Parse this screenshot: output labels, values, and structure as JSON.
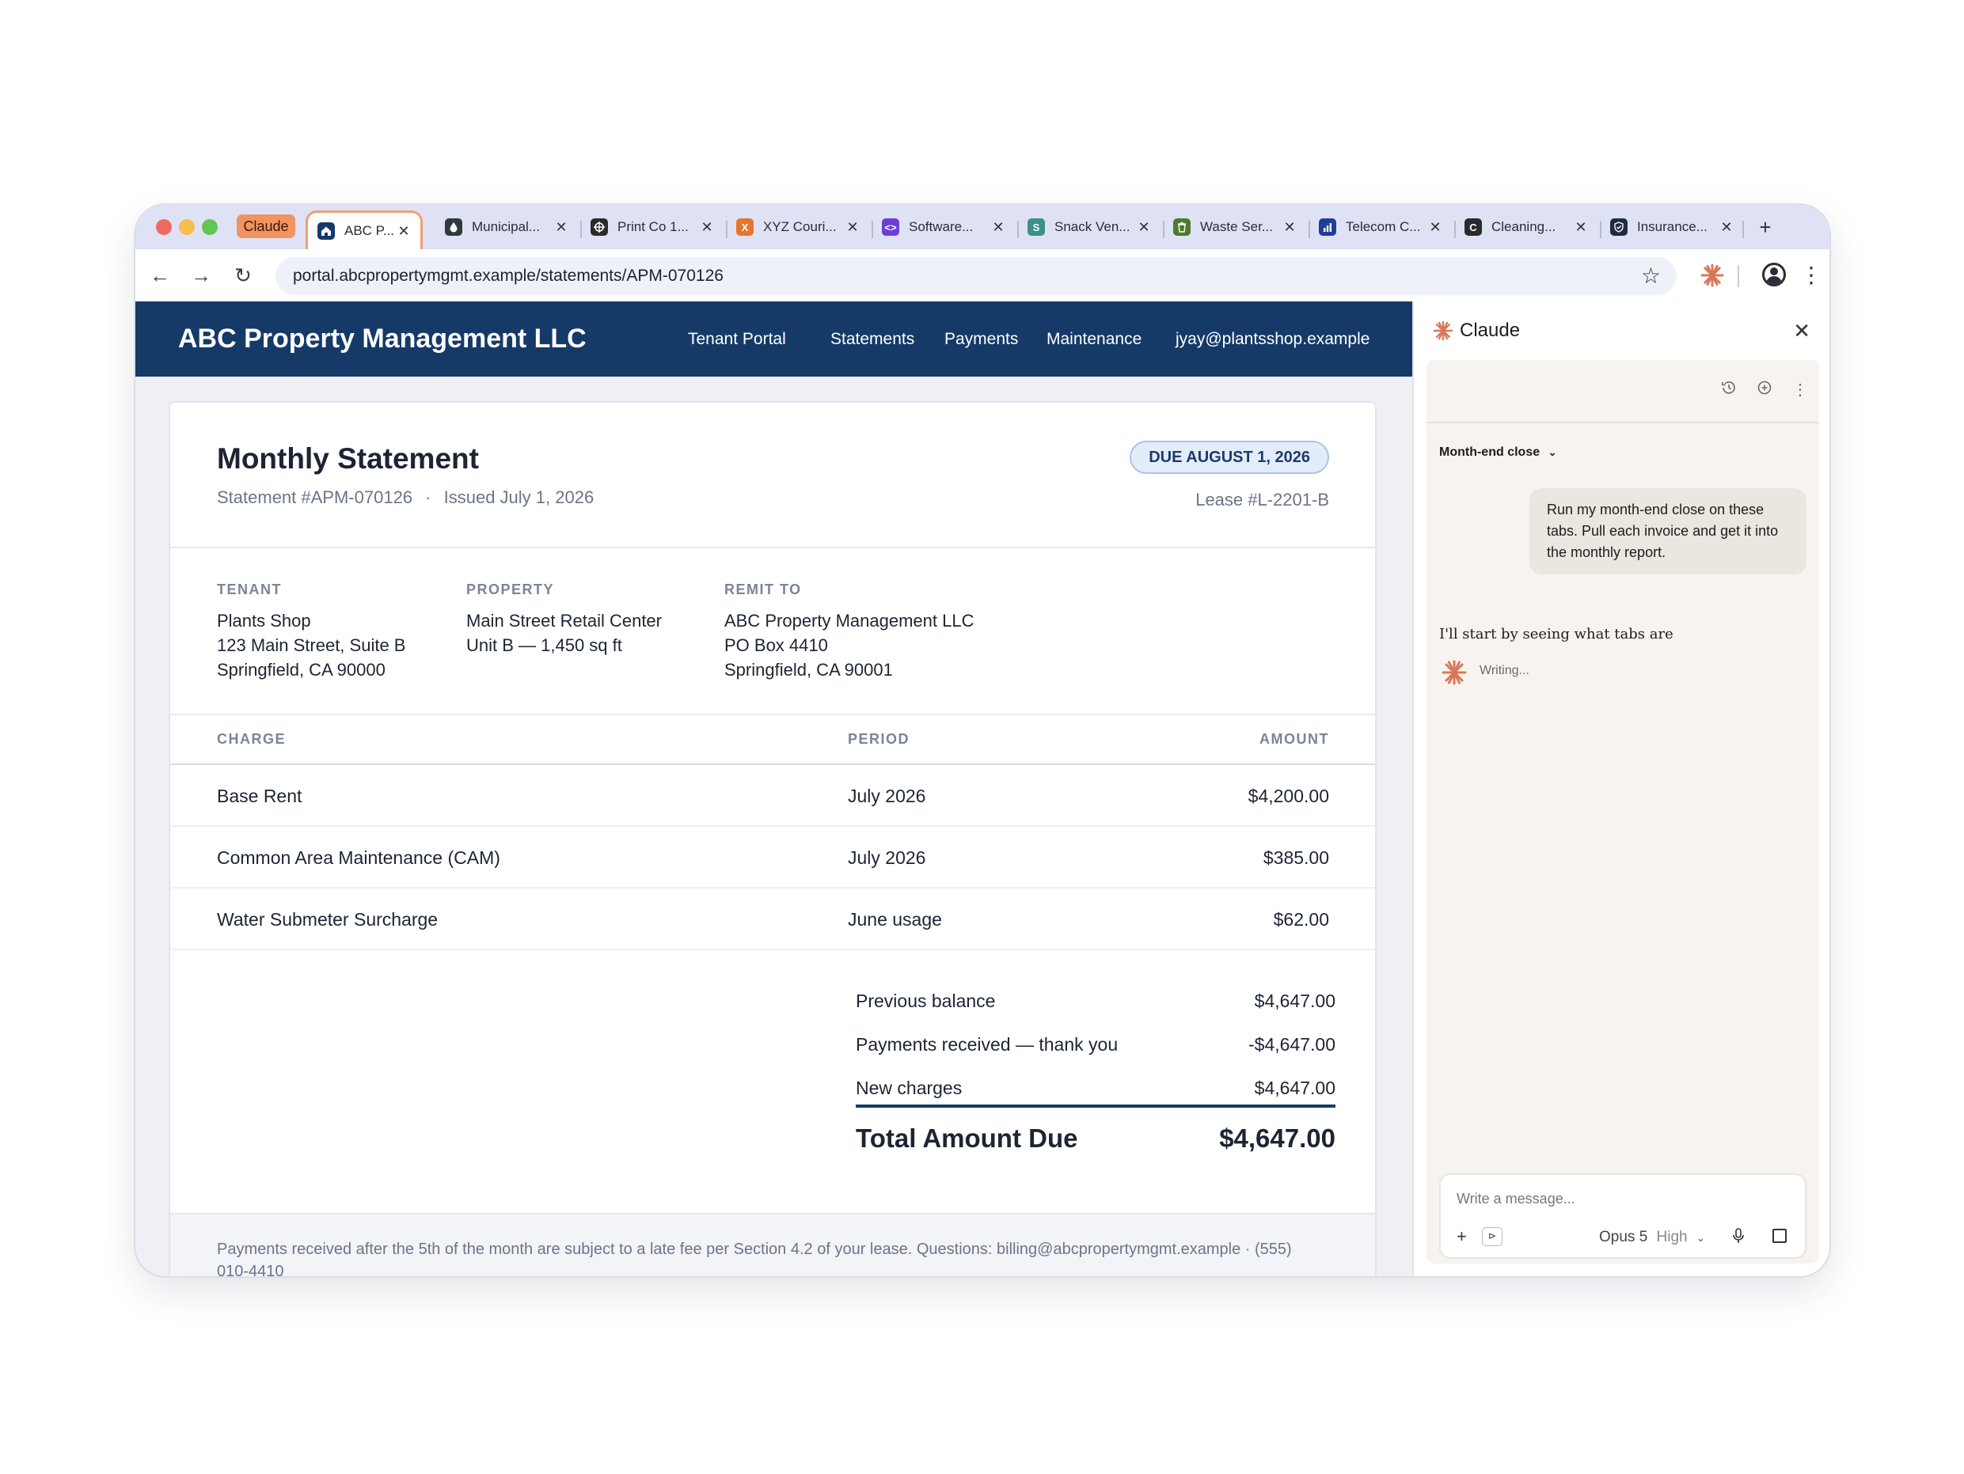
{
  "browser": {
    "claude_tab_label": "Claude",
    "tabs": [
      {
        "title": "ABC P...",
        "icon": "house-icon",
        "color": "#153a68",
        "active": true
      },
      {
        "title": "Municipal...",
        "icon": "water-drop-icon",
        "color": "#2f3a3a"
      },
      {
        "title": "Print Co 1...",
        "icon": "print-crosshair-icon",
        "color": "#2b2b2b"
      },
      {
        "title": "XYZ Couri...",
        "icon": "courier-x-icon",
        "color": "#e8742e"
      },
      {
        "title": "Software...",
        "icon": "code-icon",
        "color": "#6b3fd4"
      },
      {
        "title": "Snack Ven...",
        "icon": "snack-s-icon",
        "color": "#3f8f86"
      },
      {
        "title": "Waste Ser...",
        "icon": "trash-icon",
        "color": "#4d7a2e"
      },
      {
        "title": "Telecom C...",
        "icon": "bar-chart-icon",
        "color": "#1e3e9a"
      },
      {
        "title": "Cleaning...",
        "icon": "cleaning-c-icon",
        "color": "#2b2b2b"
      },
      {
        "title": "Insurance...",
        "icon": "shield-check-icon",
        "color": "#1f2a44"
      }
    ],
    "url": "portal.abcpropertymgmt.example/statements/APM-070126"
  },
  "site": {
    "brand": "ABC Property Management LLC",
    "nav": [
      "Tenant Portal",
      "Statements",
      "Payments",
      "Maintenance",
      "jyay@plantsshop.example"
    ]
  },
  "statement": {
    "title": "Monthly Statement",
    "number": "Statement #APM-070126",
    "issued": "Issued July 1, 2026",
    "separator": "·",
    "due_badge": "DUE AUGUST 1, 2026",
    "lease": "Lease #L-2201-B",
    "tenant": {
      "label": "TENANT",
      "lines": [
        "Plants Shop",
        "123 Main Street, Suite B",
        "Springfield, CA 90000"
      ]
    },
    "property": {
      "label": "PROPERTY",
      "lines": [
        "Main Street Retail Center",
        "Unit B — 1,450 sq ft"
      ]
    },
    "remit": {
      "label": "REMIT TO",
      "lines": [
        "ABC Property Management LLC",
        "PO Box 4410",
        "Springfield, CA 90001"
      ]
    },
    "columns": {
      "charge": "CHARGE",
      "period": "PERIOD",
      "amount": "AMOUNT"
    },
    "charges": [
      {
        "charge": "Base Rent",
        "period": "July 2026",
        "amount": "$4,200.00"
      },
      {
        "charge": "Common Area Maintenance (CAM)",
        "period": "July 2026",
        "amount": "$385.00"
      },
      {
        "charge": "Water Submeter Surcharge",
        "period": "June usage",
        "amount": "$62.00"
      }
    ],
    "summary": [
      {
        "label": "Previous balance",
        "value": "$4,647.00"
      },
      {
        "label": "Payments received — thank you",
        "value": "-$4,647.00"
      },
      {
        "label": "New charges",
        "value": "$4,647.00"
      }
    ],
    "total_label": "Total Amount Due",
    "total_value": "$4,647.00",
    "footer": "Payments received after the 5th of the month are subject to a late fee per Section 4.2 of your lease. Questions: billing@abcpropertymgmt.example · (555) 010-4410"
  },
  "claude_panel": {
    "title": "Claude",
    "mode": "Month-end close",
    "user_message": "Run my month-end close on these tabs. Pull each invoice and get it into the monthly report.",
    "assistant_message": "I'll start by seeing what tabs are",
    "status": "Writing...",
    "composer_placeholder": "Write a message...",
    "model": "Opus 5",
    "effort": "High"
  },
  "colors": {
    "brand_navy": "#153a68",
    "claude_accent": "#d97757",
    "tab_highlight": "#f0a070"
  }
}
